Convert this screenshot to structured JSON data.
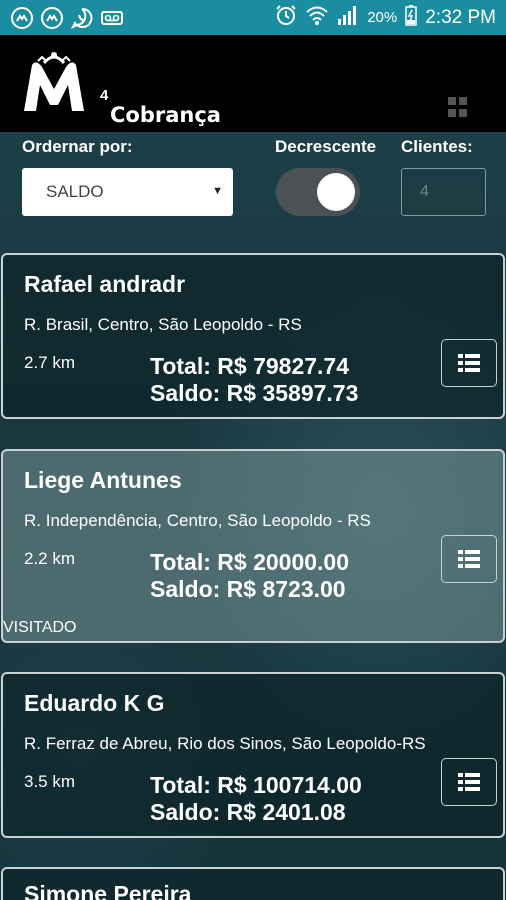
{
  "status_bar": {
    "battery_percent": "20%",
    "time": "2:32 PM",
    "left_icons": [
      "messenger-icon",
      "messenger-icon",
      "whatsapp-icon",
      "voicemail-icon"
    ],
    "right_icons": [
      "alarm-icon",
      "wifi-icon",
      "signal-icon",
      "battery-charging-icon"
    ]
  },
  "header": {
    "logo_superscript": "4",
    "logo_text": "Cobrança"
  },
  "controls": {
    "order_label": "Ordernar por:",
    "order_value": "SALDO",
    "desc_label": "Decrescente",
    "desc_on": true,
    "clients_label": "Clientes:",
    "clients_value": "4"
  },
  "customers": [
    {
      "name": "Rafael andradr",
      "address": "R. Brasil, Centro, São Leopoldo - RS",
      "distance": "2.7 km",
      "total": "Total: R$ 79827.74",
      "saldo": "Saldo: R$ 35897.73",
      "status": ""
    },
    {
      "name": "Liege Antunes",
      "address": "R. Independência, Centro, São Leopoldo - RS",
      "distance": "2.2 km",
      "total": "Total: R$ 20000.00",
      "saldo": "Saldo: R$ 8723.00",
      "status": "VISITADO"
    },
    {
      "name": "Eduardo K G",
      "address": "R. Ferraz de Abreu, Rio dos Sinos, São Leopoldo-RS",
      "distance": "3.5 km",
      "total": "Total: R$ 100714.00",
      "saldo": "Saldo: R$ 2401.08",
      "status": ""
    },
    {
      "name": "Simone Pereira",
      "address": "",
      "distance": "",
      "total": "",
      "saldo": "",
      "status": ""
    }
  ],
  "colors": {
    "status_bar": "#1a8da0",
    "header": "#000000",
    "background": "#173840",
    "card_border": "#c9d2d3"
  }
}
